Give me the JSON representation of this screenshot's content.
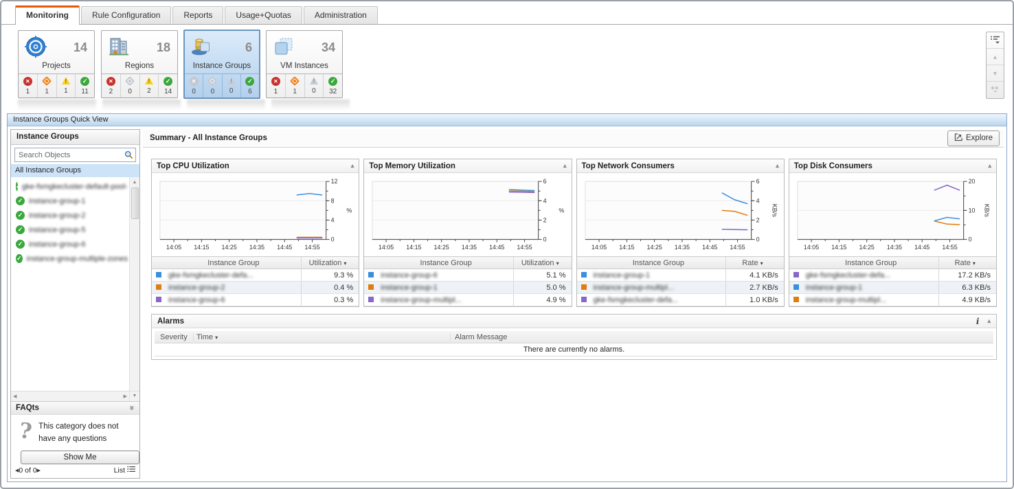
{
  "tabs": [
    {
      "label": "Monitoring",
      "active": true
    },
    {
      "label": "Rule Configuration",
      "active": false
    },
    {
      "label": "Reports",
      "active": false
    },
    {
      "label": "Usage+Quotas",
      "active": false
    },
    {
      "label": "Administration",
      "active": false
    }
  ],
  "tiles": [
    {
      "label": "Projects",
      "count": "14",
      "statuses": [
        {
          "icon_class": "sicon fatal s-red",
          "count": "1"
        },
        {
          "icon_class": "sicon critical s-orange",
          "count": "1"
        },
        {
          "icon_class": "sicon warning",
          "count": "1"
        },
        {
          "icon_class": "sicon normal s-green",
          "count": "11"
        }
      ]
    },
    {
      "label": "Regions",
      "count": "18",
      "statuses": [
        {
          "icon_class": "sicon fatal s-red",
          "count": "2"
        },
        {
          "icon_class": "sicon critical s-gray",
          "count": "0"
        },
        {
          "icon_class": "sicon warning",
          "count": "2"
        },
        {
          "icon_class": "sicon normal s-green",
          "count": "14"
        }
      ]
    },
    {
      "label": "Instance Groups",
      "count": "6",
      "statuses": [
        {
          "icon_class": "sicon fatal s-gray",
          "count": "0"
        },
        {
          "icon_class": "sicon critical s-gray",
          "count": "0"
        },
        {
          "icon_class": "sicon warning t-gray",
          "count": "0"
        },
        {
          "icon_class": "sicon normal s-green",
          "count": "6"
        }
      ]
    },
    {
      "label": "VM Instances",
      "count": "34",
      "statuses": [
        {
          "icon_class": "sicon fatal s-red",
          "count": "1"
        },
        {
          "icon_class": "sicon critical s-orange",
          "count": "1"
        },
        {
          "icon_class": "sicon warning t-gray",
          "count": "0"
        },
        {
          "icon_class": "sicon normal s-green",
          "count": "32"
        }
      ]
    }
  ],
  "quickview": {
    "title": "Instance Groups Quick View",
    "sidebar": {
      "title": "Instance Groups",
      "search_placeholder": "Search Objects",
      "all_label": "All Instance Groups",
      "groups": [
        {
          "name": "gke-fsmgkecluster-default-pool-"
        },
        {
          "name": "instance-group-1"
        },
        {
          "name": "instance-group-2"
        },
        {
          "name": "instance-group-5"
        },
        {
          "name": "instance-group-6"
        },
        {
          "name": "instance-group-multiple-zones"
        }
      ],
      "faqts": {
        "title": "FAQts",
        "message": "This category does not have any questions",
        "button": "Show Me",
        "pagination": "0 of 0",
        "list_label": "List"
      }
    },
    "summary": {
      "title": "Summary - All Instance Groups",
      "explore": "Explore"
    },
    "panels": [
      {
        "title": "Top CPU Utilization",
        "name_header": "Instance Group",
        "value_header": "Utilization"
      },
      {
        "title": "Top Memory Utilization",
        "name_header": "Instance Group",
        "value_header": "Utilization"
      },
      {
        "title": "Top Network Consumers",
        "name_header": "Instance Group",
        "value_header": "Rate"
      },
      {
        "title": "Top Disk Consumers",
        "name_header": "Instance Group",
        "value_header": "Rate"
      }
    ],
    "alarms": {
      "title": "Alarms",
      "columns": [
        "Severity",
        "Time",
        "Alarm Message"
      ],
      "empty": "There are currently no alarms."
    }
  },
  "chart_data": [
    {
      "type": "line",
      "title": "Top CPU Utilization",
      "xlabel": "",
      "ylabel": "%",
      "ylim": [
        0,
        12
      ],
      "yticks": [
        0,
        4,
        8,
        12
      ],
      "yminor": 2,
      "xticks": [
        "14:05",
        "14:15",
        "14:25",
        "14:35",
        "14:45",
        "14:55"
      ],
      "series": [
        {
          "name": "gke-fsmgkecluster-defa...",
          "color": "#3a8fdd",
          "display_value": "9.3 %",
          "x": [
            49.5,
            54,
            58.5
          ],
          "y": [
            9.2,
            9.5,
            9.2
          ]
        },
        {
          "name": "instance-group-2",
          "color": "#e07d10",
          "display_value": "0.4 %",
          "x": [
            49.5,
            58.5
          ],
          "y": [
            0.45,
            0.45
          ]
        },
        {
          "name": "instance-group-6",
          "color": "#8767c8",
          "display_value": "0.3 %",
          "x": [
            49.5,
            58.5
          ],
          "y": [
            0.3,
            0.3
          ]
        }
      ]
    },
    {
      "type": "line",
      "title": "Top Memory Utilization",
      "xlabel": "",
      "ylabel": "%",
      "ylim": [
        0,
        6
      ],
      "yticks": [
        0,
        2,
        4,
        6
      ],
      "yminor": 1,
      "xticks": [
        "14:05",
        "14:15",
        "14:25",
        "14:35",
        "14:45",
        "14:55"
      ],
      "series": [
        {
          "name": "instance-group-6",
          "color": "#3a8fdd",
          "display_value": "5.1 %",
          "x": [
            49.5,
            58.5
          ],
          "y": [
            5.15,
            5.05
          ]
        },
        {
          "name": "instance-group-1",
          "color": "#e07d10",
          "display_value": "5.0 %",
          "x": [
            49.5,
            58.5
          ],
          "y": [
            5.0,
            4.95
          ]
        },
        {
          "name": "instance-group-multipl...",
          "color": "#8767c8",
          "display_value": "4.9 %",
          "x": [
            49.5,
            58.5
          ],
          "y": [
            4.9,
            4.85
          ]
        }
      ]
    },
    {
      "type": "line",
      "title": "Top Network Consumers",
      "xlabel": "",
      "ylabel": "KB/s",
      "ylim": [
        0,
        6
      ],
      "yticks": [
        0,
        2,
        4,
        6
      ],
      "yminor": 1,
      "xticks": [
        "14:05",
        "14:15",
        "14:25",
        "14:35",
        "14:45",
        "14:55"
      ],
      "series": [
        {
          "name": "instance-group-1",
          "color": "#3a8fdd",
          "display_value": "4.1 KB/s",
          "x": [
            49.5,
            54,
            58.5
          ],
          "y": [
            4.8,
            4.1,
            3.7
          ]
        },
        {
          "name": "instance-group-multipl...",
          "color": "#e07d10",
          "display_value": "2.7 KB/s",
          "x": [
            49.5,
            54,
            58.5
          ],
          "y": [
            3.0,
            2.9,
            2.5
          ]
        },
        {
          "name": "gke-fsmgkecluster-defa...",
          "color": "#8767c8",
          "display_value": "1.0 KB/s",
          "x": [
            49.5,
            58.5
          ],
          "y": [
            1.05,
            1.0
          ]
        }
      ]
    },
    {
      "type": "line",
      "title": "Top Disk Consumers",
      "xlabel": "",
      "ylabel": "KB/s",
      "ylim": [
        0,
        20
      ],
      "yticks": [
        0,
        10,
        20
      ],
      "yminor": 5,
      "xticks": [
        "14:05",
        "14:15",
        "14:25",
        "14:35",
        "14:45",
        "14:55"
      ],
      "series": [
        {
          "name": "gke-fsmgkecluster-defa...",
          "color": "#8767c8",
          "display_value": "17.2 KB/s",
          "x": [
            49.5,
            54,
            58.5
          ],
          "y": [
            17.0,
            18.7,
            17.0
          ]
        },
        {
          "name": "instance-group-1",
          "color": "#3a8fdd",
          "display_value": "6.3 KB/s",
          "x": [
            49.5,
            54,
            58.5
          ],
          "y": [
            6.4,
            7.6,
            7.1
          ]
        },
        {
          "name": "instance-group-multipl...",
          "color": "#e07d10",
          "display_value": "4.9 KB/s",
          "x": [
            49.5,
            54,
            58.5
          ],
          "y": [
            6.3,
            5.3,
            5.1
          ]
        }
      ]
    }
  ]
}
